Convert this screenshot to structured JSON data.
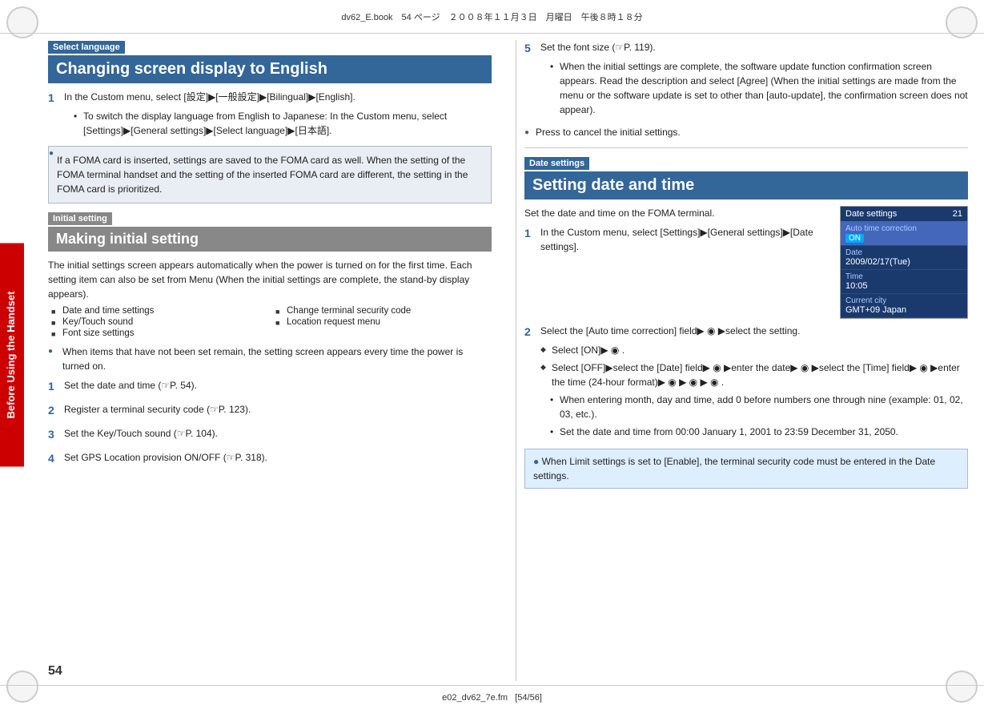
{
  "header": {
    "text": "dv62_E.book　54 ページ　２００８年１１月３日　月曜日　午後８時１８分"
  },
  "footer": {
    "left": "e02_dv62_7e.fm",
    "right": "[54/56]"
  },
  "page_number": "54",
  "sidebar_label": "Before Using the Handset",
  "left_col": {
    "section1": {
      "label": "Select language",
      "heading": "Changing screen display to English",
      "step1": {
        "num": "1",
        "text": "In the Custom menu, select [設定]▶[一般設定]▶[Bilingual]▶[English].",
        "bullet1": "To switch the display language from English to Japanese: In the Custom menu, select [Settings]▶[General settings]▶[Select language]▶[日本語]."
      },
      "info_box": "If a FOMA card is inserted, settings are saved to the FOMA card as well. When the setting of the FOMA terminal handset and the setting of the inserted FOMA card are different, the setting in the FOMA card is prioritized."
    },
    "section2": {
      "label": "Initial setting",
      "heading": "Making initial setting",
      "intro": "The initial settings screen appears automatically when the power is turned on for the first time. Each setting item can also be set from Menu (When the initial settings are complete, the stand-by display appears).",
      "sq_items": [
        "Date and time settings",
        "Change terminal security code",
        "Key/Touch sound",
        "Location request menu",
        "Font size settings"
      ],
      "when_note": "When items that have not been set remain, the setting screen appears every time the power is turned on.",
      "steps": [
        {
          "num": "1",
          "text": "Set the date and time (☞P. 54)."
        },
        {
          "num": "2",
          "text": "Register a terminal security code (☞P. 123)."
        },
        {
          "num": "3",
          "text": "Set the Key/Touch sound (☞P. 104)."
        },
        {
          "num": "4",
          "text": "Set GPS Location provision ON/OFF (☞P. 318)."
        }
      ]
    }
  },
  "right_col": {
    "step5": {
      "num": "5",
      "text": "Set the font size (☞P. 119).",
      "bullet": "When the initial settings are complete, the software update function confirmation screen appears. Read the description and select [Agree] (When the initial settings are made from the menu or the software update is set to other than [auto-update], the confirmation screen does not appear)."
    },
    "press_note": "Press  to cancel the initial settings.",
    "section3": {
      "label": "Date settings",
      "heading": "Setting date and time",
      "intro": "Set the date and time on the FOMA terminal.",
      "screenshot": {
        "title": "Date settings",
        "num": "21",
        "rows": [
          {
            "label": "Auto time correction",
            "value": "ON",
            "highlight": true
          },
          {
            "label": "Date",
            "value": "2009/02/17(Tue)"
          },
          {
            "label": "Time",
            "value": "10:05"
          },
          {
            "label": "Current city",
            "value": "GMT+09 Japan"
          }
        ]
      },
      "step1": {
        "num": "1",
        "text": "In the Custom menu, select [Settings]▶[General settings]▶[Date settings]."
      },
      "step2": {
        "num": "2",
        "text": "Select the [Auto time correction] field▶ ◉ ▶select the setting.",
        "diamonds": [
          "Select [ON]▶ ◉ .",
          "Select [OFF]▶select the [Date] field▶ ◉ ▶enter the date▶ ◉ ▶select the [Time] field▶ ◉ ▶enter the time (24-hour format)▶ ◉ ▶ ◉ ▶ ◉ ."
        ],
        "bullets": [
          "When entering month, day and time, add 0 before numbers one through nine (example: 01, 02, 03, etc.).",
          "Set the date and time from 00:00 January 1, 2001 to 23:59 December 31, 2050."
        ]
      },
      "bottom_note": "When Limit settings is set to [Enable], the terminal security code must be entered in the Date settings."
    }
  }
}
